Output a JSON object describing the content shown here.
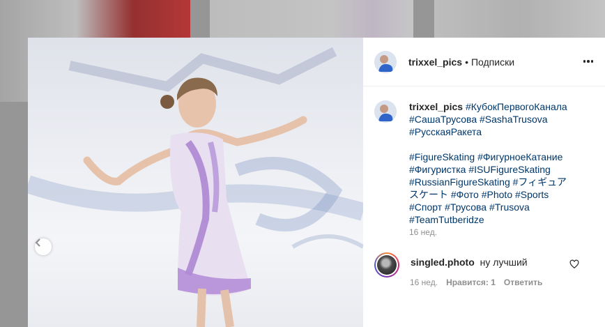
{
  "post": {
    "username": "trixxel_pics",
    "separator": "•",
    "follow_label": "Подписки",
    "caption_username": "trixxel_pics",
    "hashtags_line1": [
      "#КубокПервогоКанала",
      "#СашаТрусова",
      "#SashaTrusova",
      "#РусскаяРакета"
    ],
    "hashtags_line2": [
      "#FigureSkating",
      "#ФигурноеКатание",
      "#Фигуристка",
      "#ISUFigureSkating",
      "#RussianFigureSkating",
      "#フィギュアスケート",
      "#Фото",
      "#Photo",
      "#Sports",
      "#Спорт",
      "#Трусова",
      "#Trusova",
      "#TeamTutberidze"
    ],
    "time": "16 нед."
  },
  "comment": {
    "username": "singled.photo",
    "text": "ну лучший",
    "time": "16 нед.",
    "likes_label": "Нравится: 1",
    "reply_label": "Ответить"
  },
  "icons": {
    "prev": "chevron-left-icon",
    "more": "more-horizontal-icon",
    "like": "heart-outline-icon"
  }
}
